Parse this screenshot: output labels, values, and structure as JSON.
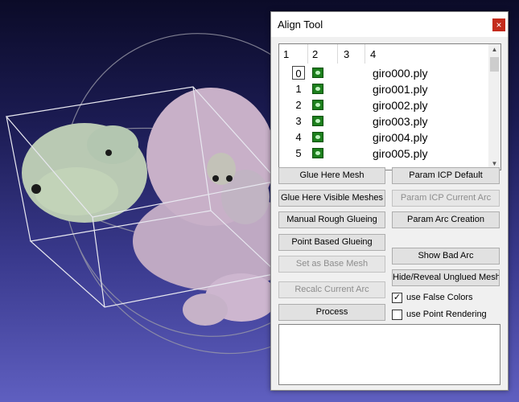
{
  "window": {
    "title": "Align Tool",
    "close_glyph": "×"
  },
  "mesh_list": {
    "columns": [
      "1",
      "2",
      "3",
      "4"
    ],
    "rows": [
      {
        "id": "0",
        "file": "giro000.ply",
        "visible_icon": "eye-icon"
      },
      {
        "id": "1",
        "file": "giro001.ply",
        "visible_icon": "eye-icon"
      },
      {
        "id": "2",
        "file": "giro002.ply",
        "visible_icon": "eye-icon"
      },
      {
        "id": "3",
        "file": "giro003.ply",
        "visible_icon": "eye-icon"
      },
      {
        "id": "4",
        "file": "giro004.ply",
        "visible_icon": "eye-icon"
      },
      {
        "id": "5",
        "file": "giro005.ply",
        "visible_icon": "eye-icon"
      }
    ],
    "selected_row": "0"
  },
  "buttons": {
    "glue_here_mesh": "Glue Here Mesh",
    "param_icp_default": "Param ICP Default",
    "glue_here_visible": "Glue Here Visible Meshes",
    "param_icp_current_arc": "Param ICP Current Arc",
    "manual_rough_glueing": "Manual Rough Glueing",
    "param_arc_creation": "Param Arc Creation",
    "point_based_glueing": "Point Based Glueing",
    "set_as_base_mesh": "Set as Base Mesh",
    "show_bad_arc": "Show Bad Arc",
    "hide_reveal_unglued": "Hide/Reveal Unglued Mesh",
    "recalc_current_arc": "Recalc Current Arc",
    "process": "Process"
  },
  "checkboxes": {
    "false_colors": {
      "label": "use False Colors",
      "checked": true,
      "mark": "✓"
    },
    "point_rendering": {
      "label": "use Point Rendering",
      "checked": false
    }
  },
  "colors": {
    "background_top": "#0b0b28",
    "background_bottom": "#5f5fc0",
    "mesh": "#c9b3c8",
    "close_button": "#c42b1c"
  }
}
